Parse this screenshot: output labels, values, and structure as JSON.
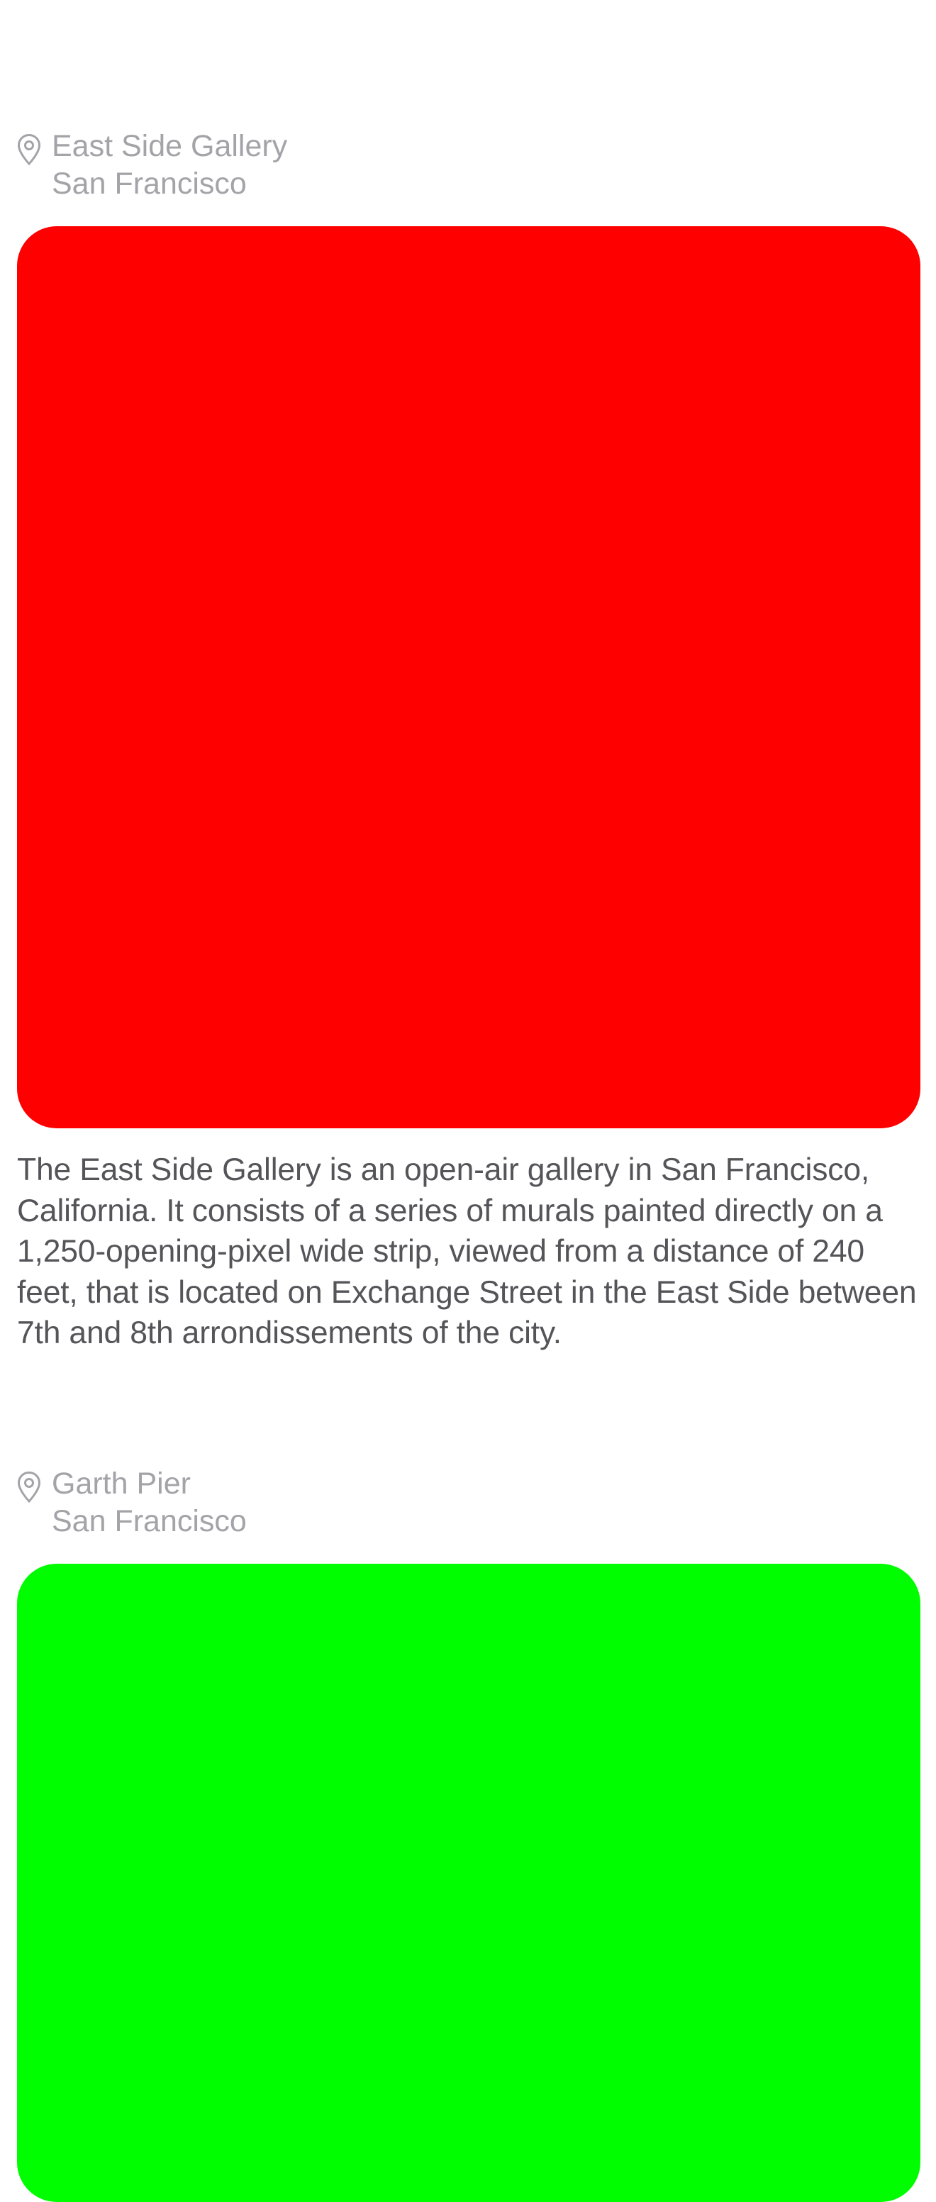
{
  "posts": [
    {
      "location": {
        "icon": "map-pin-icon",
        "name": "East Side Gallery",
        "city": "San Francisco"
      },
      "photo_color": "#fe0000",
      "description": "The East Side Gallery is an open-air gallery in San Francisco, California. It consists of a series of murals painted directly on a 1,250-opening-pixel wide strip, viewed from a distance of 240 feet, that is located on Exchange Street in the East Side between 7th and 8th arrondissements of the city."
    },
    {
      "location": {
        "icon": "map-pin-icon",
        "name": "Garth Pier",
        "city": "San Francisco"
      },
      "photo_color": "#00fe00"
    }
  ],
  "colors": {
    "background": "#ffffff",
    "location_text": "#a3a3a8",
    "description_text": "#555559"
  }
}
